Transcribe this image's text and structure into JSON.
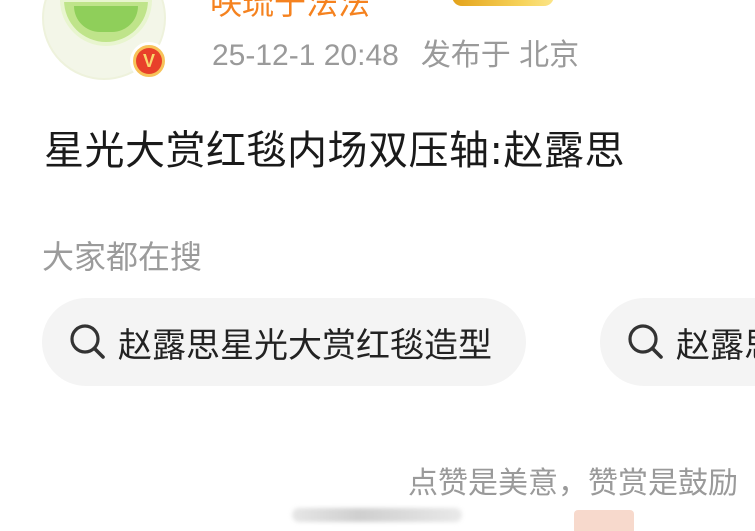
{
  "post": {
    "username": "咲琉于法法",
    "timestamp": "25-12-1 20:48",
    "location": "发布于 北京",
    "verified_mark": "V",
    "headline": "星光大赏红毯内场双压轴:赵露思"
  },
  "search": {
    "title": "大家都在搜",
    "chips": [
      {
        "label": "赵露思星光大赏红毯造型",
        "icon": "search-icon"
      },
      {
        "label": "赵露思",
        "icon": "search-icon"
      }
    ]
  },
  "footer": {
    "encourage_text": "点赞是美意，赞赏是鼓励"
  },
  "colors": {
    "username": "#f5821f",
    "meta": "#9a9a9a",
    "chip_bg": "#f4f4f4",
    "verified": "#e8402a"
  }
}
